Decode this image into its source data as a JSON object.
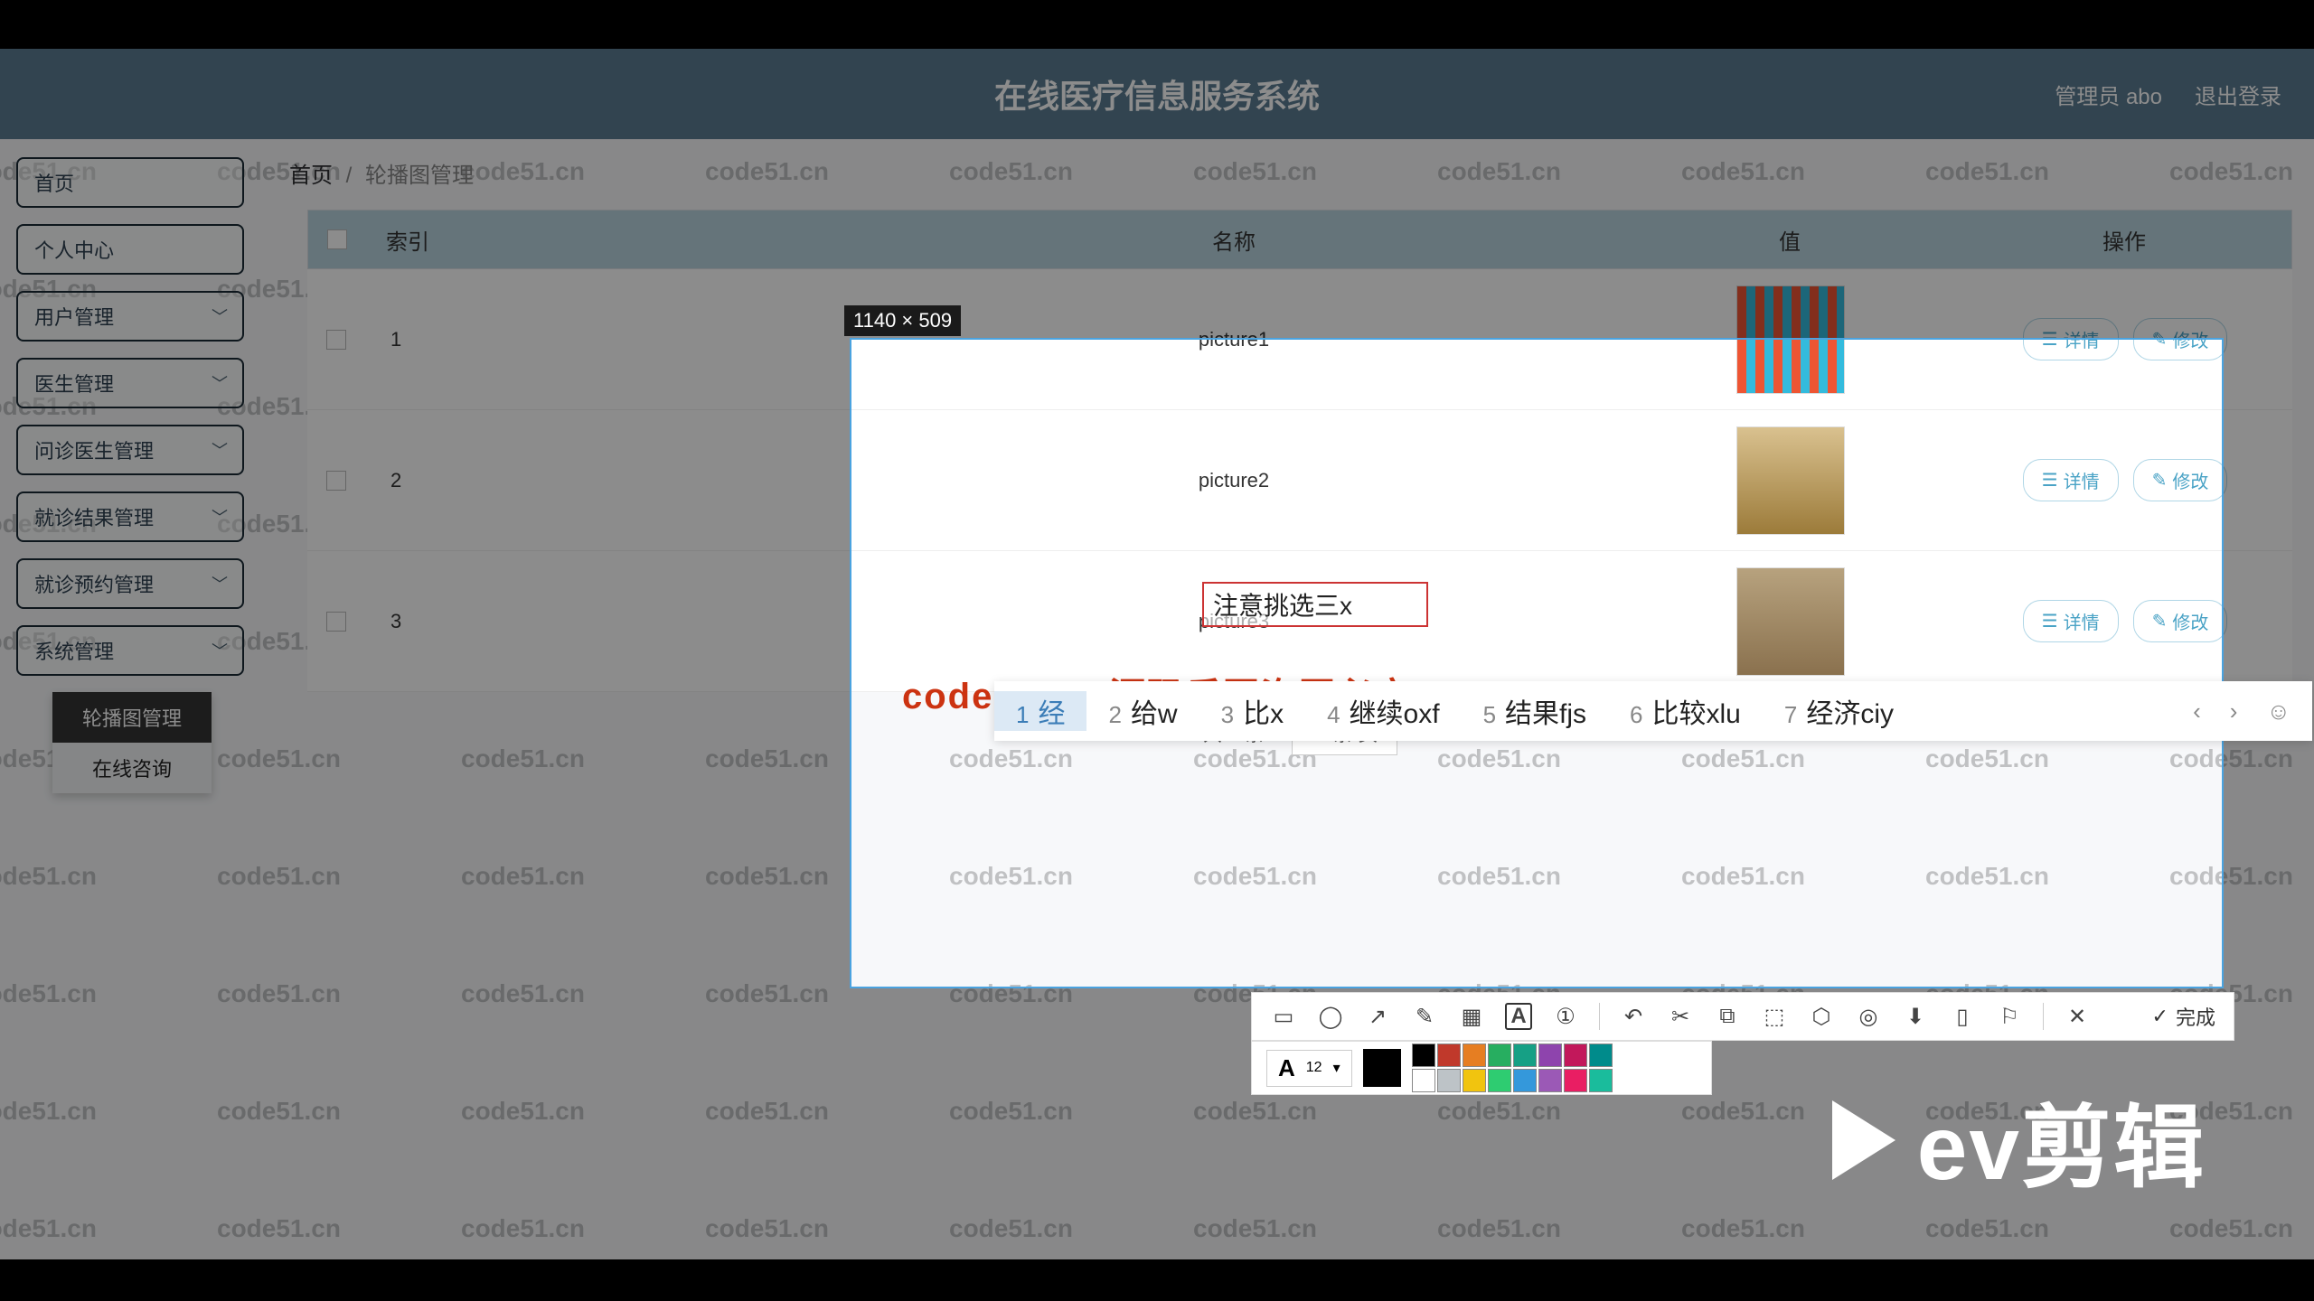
{
  "header": {
    "title": "在线医疗信息服务系统",
    "admin": "管理员 abo",
    "logout": "退出登录"
  },
  "sidebar": {
    "items": [
      "首页",
      "个人中心",
      "用户管理",
      "医生管理",
      "问诊医生管理",
      "就诊结果管理",
      "就诊预约管理",
      "系统管理"
    ],
    "sub": {
      "active": "轮播图管理",
      "other": "在线咨询"
    }
  },
  "breadcrumb": {
    "b1": "首页",
    "b2": "轮播图管理"
  },
  "table": {
    "cols": {
      "idx": "索引",
      "name": "名称",
      "val": "值",
      "op": "操作"
    },
    "rows": [
      {
        "idx": "1",
        "name": "picture1"
      },
      {
        "idx": "2",
        "name": "picture2"
      },
      {
        "idx": "3",
        "name": "picture3"
      }
    ],
    "btn_detail": "详情",
    "btn_edit": "修改"
  },
  "pagination": {
    "total": "共 3 条",
    "per": "10条/页"
  },
  "snip": {
    "dimensions": "1140 × 509",
    "done": "完成",
    "text_input": "注意挑选三x",
    "font_size": "12"
  },
  "ime": {
    "candidates": [
      {
        "n": "1",
        "t": "经"
      },
      {
        "n": "2",
        "t": "给w"
      },
      {
        "n": "3",
        "t": "比x"
      },
      {
        "n": "4",
        "t": "继续oxf"
      },
      {
        "n": "5",
        "t": "结果fjs"
      },
      {
        "n": "6",
        "t": "比较xlu"
      },
      {
        "n": "7",
        "t": "经济ciy"
      }
    ]
  },
  "palette": [
    "#000000",
    "#c0392b",
    "#e67e22",
    "#27ae60",
    "#16a085",
    "#8e44ad",
    "#c2185b",
    "#008b8b",
    "#ffffff",
    "#bdc3c7",
    "#f1c40f",
    "#2ecc71",
    "#3498db",
    "#9b59b6",
    "#e91e63",
    "#1abc9c"
  ],
  "red_watermark": "code51.cn-源码乐园盗图必究",
  "watermark_text": "code51.cn",
  "logo": "ev剪辑"
}
